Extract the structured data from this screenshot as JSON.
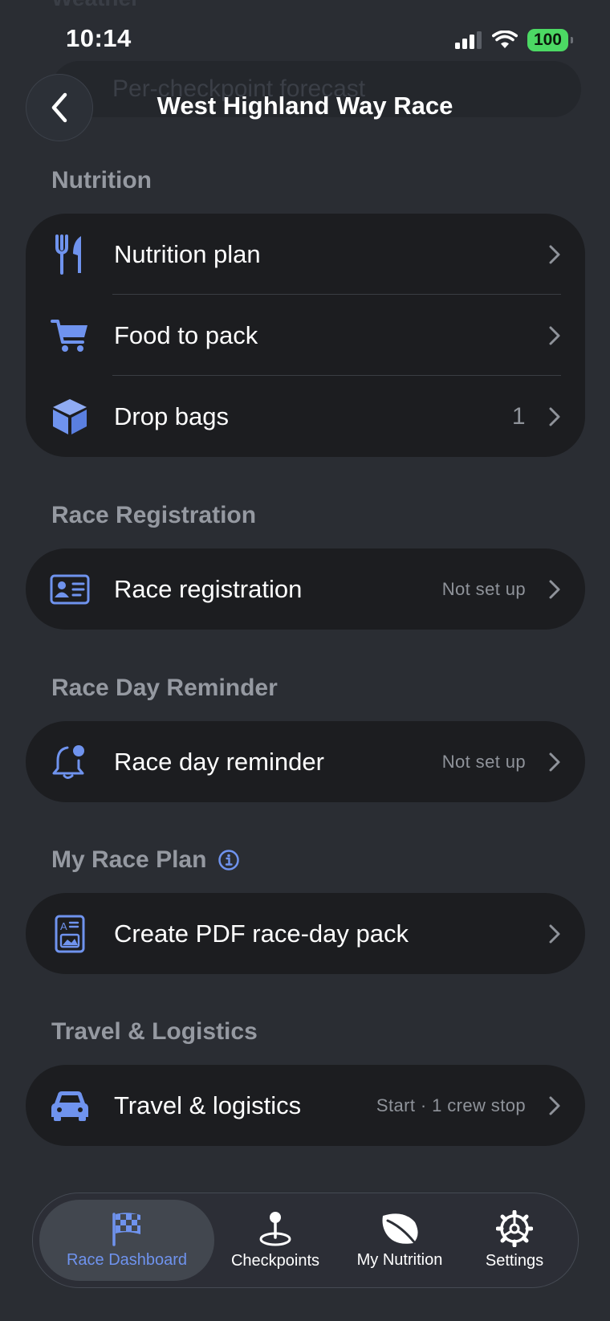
{
  "status_bar": {
    "time": "10:14",
    "battery": "100"
  },
  "header": {
    "title": "West Highland Way Race",
    "behind_text": "Per-checkpoint forecast",
    "behind_section": "Weather"
  },
  "sections": {
    "nutrition": {
      "label": "Nutrition",
      "rows": [
        {
          "label": "Nutrition plan",
          "value": "",
          "icon": "fork-knife-icon"
        },
        {
          "label": "Food to pack",
          "value": "",
          "icon": "cart-icon"
        },
        {
          "label": "Drop bags",
          "value": "1",
          "icon": "box-icon"
        }
      ]
    },
    "registration": {
      "label": "Race Registration",
      "row": {
        "label": "Race registration",
        "value": "Not set up",
        "icon": "id-card-icon"
      }
    },
    "reminder": {
      "label": "Race Day Reminder",
      "row": {
        "label": "Race day reminder",
        "value": "Not set up",
        "icon": "bell-icon"
      }
    },
    "plan": {
      "label": "My Race Plan",
      "row": {
        "label": "Create PDF race-day pack",
        "value": "",
        "icon": "document-icon"
      }
    },
    "travel": {
      "label": "Travel & Logistics",
      "row": {
        "label": "Travel & logistics",
        "value": "Start · 1 crew stop",
        "icon": "car-icon"
      }
    }
  },
  "tab_bar": [
    {
      "label": "Race Dashboard",
      "icon": "checkered-flag-icon",
      "active": true
    },
    {
      "label": "Checkpoints",
      "icon": "map-pin-icon",
      "active": false
    },
    {
      "label": "My Nutrition",
      "icon": "leaf-icon",
      "active": false
    },
    {
      "label": "Settings",
      "icon": "gear-icon",
      "active": false
    }
  ],
  "colors": {
    "background": "#2a2d33",
    "card": "#1c1d20",
    "accent": "#6f93ee",
    "section_label": "#9599a1",
    "battery": "#4cd964"
  }
}
